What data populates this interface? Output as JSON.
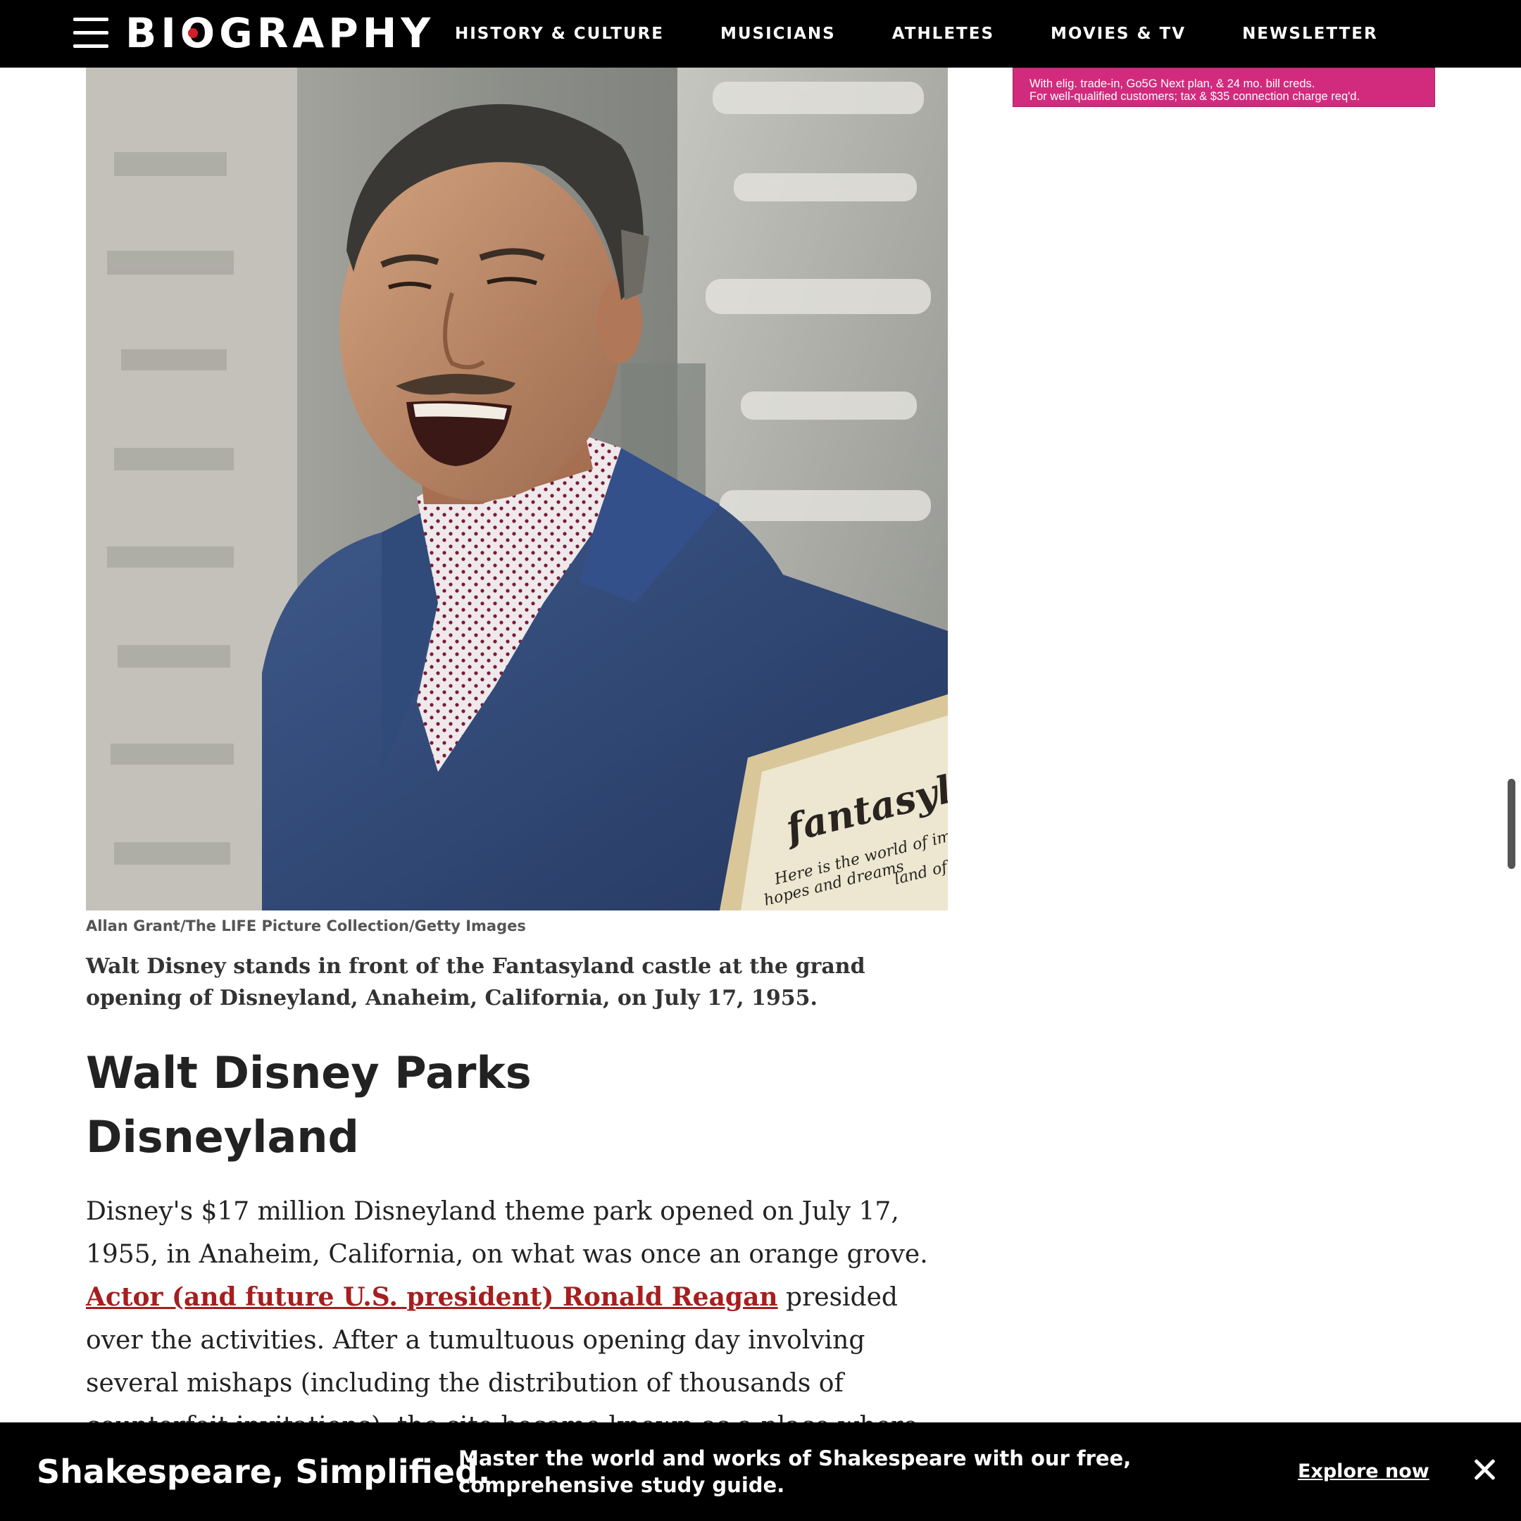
{
  "nav": {
    "logo": "BIOGRAPHY",
    "links": [
      "HISTORY & CULTURE",
      "MUSICIANS",
      "ATHLETES",
      "MOVIES & TV",
      "NEWSLETTER"
    ]
  },
  "ad": {
    "line1": "With elig. trade-in, Go5G Next plan, & 24 mo. bill creds.",
    "line2": "For well-qualified customers; tax & $35 connection charge req'd."
  },
  "photo": {
    "sign_word": "fantasyl",
    "sign_sub1": "Here is the world of ima",
    "sign_sub2": "hopes and dreams",
    "sign_sub3": "land of en"
  },
  "article": {
    "credit": "Allan Grant/The LIFE Picture Collection/Getty Images",
    "caption": "Walt Disney stands in front of the Fantasyland castle at the grand opening of Disneyland, Anaheim, California, on July 17, 1955.",
    "h2": "Walt Disney Parks",
    "h3": "Disneyland",
    "p_part1": "Disney's $17 million Disneyland theme park opened on July 17, 1955, in Anaheim, California, on what was once an orange grove. ",
    "p_link": "Actor (and future U.S. president) Ronald Reagan",
    "p_part2": " presided over the activities. After a tumultuous opening day involving several mishaps (including the distribution of thousands of counterfeit invitations), the site became known as a place where children and their families could explore, enjoy"
  },
  "banner": {
    "title": "Shakespeare, Simplified.",
    "text": "Master the world and works of Shakespeare with our free, comprehensive study guide.",
    "cta": "Explore now"
  },
  "colors": {
    "nav_bg": "#000000",
    "ad_bg": "#d22b7d",
    "link": "#a61e1e",
    "logo_dot": "#d31f2a"
  }
}
